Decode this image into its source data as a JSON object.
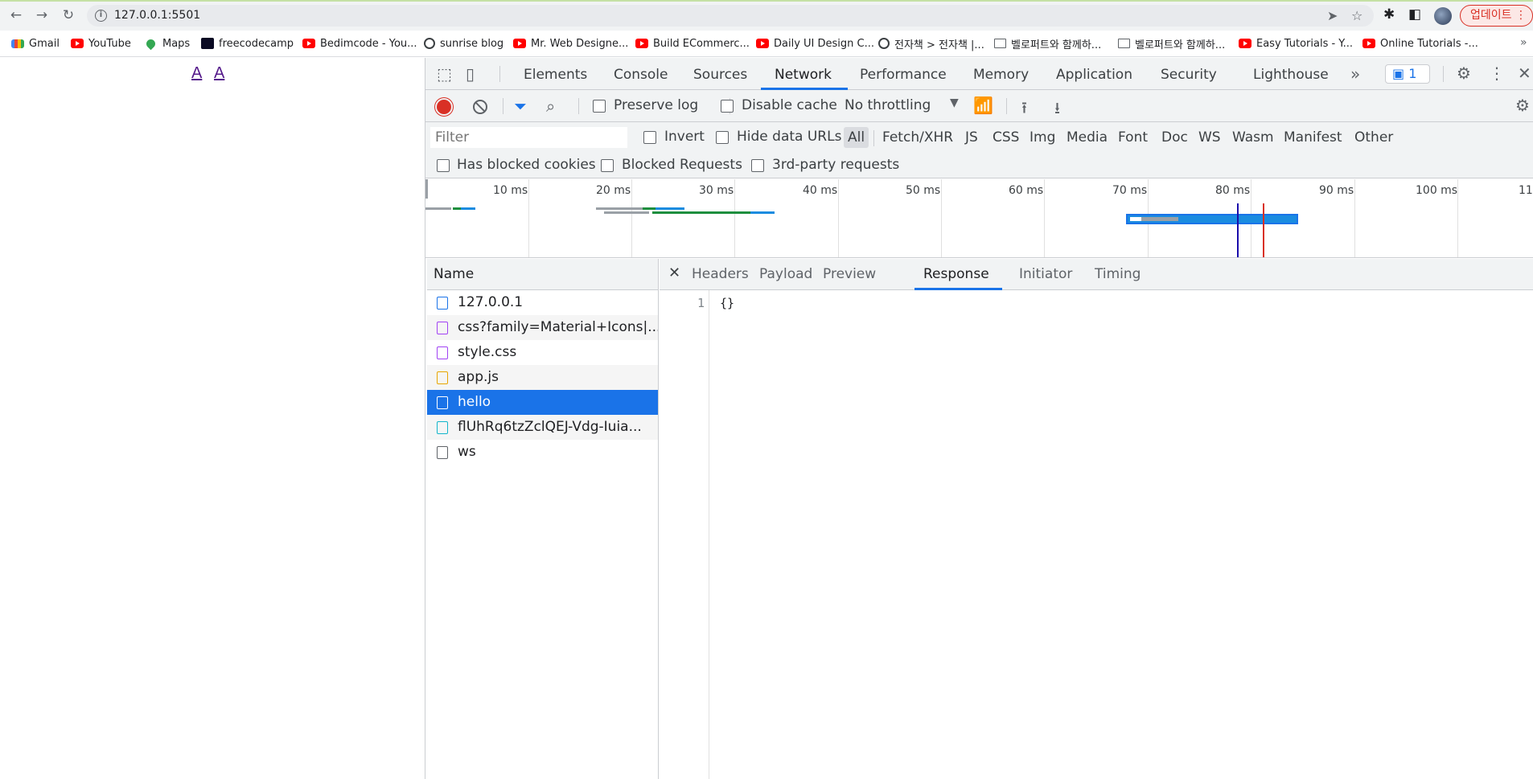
{
  "browser": {
    "url": "127.0.0.1:5501",
    "update_label": "업데이트",
    "bookmarks": [
      {
        "label": "Gmail",
        "icon": "gmail-icon"
      },
      {
        "label": "YouTube",
        "icon": "youtube-icon"
      },
      {
        "label": "Maps",
        "icon": "maps-icon"
      },
      {
        "label": "freecodecamp",
        "icon": "freecodecamp-icon"
      },
      {
        "label": "Bedimcode - You...",
        "icon": "youtube-icon"
      },
      {
        "label": "sunrise blog",
        "icon": "globe-icon"
      },
      {
        "label": "Mr. Web Designe...",
        "icon": "youtube-icon"
      },
      {
        "label": "Build ECommerc...",
        "icon": "youtube-icon"
      },
      {
        "label": "Daily UI Design C...",
        "icon": "youtube-icon"
      },
      {
        "label": "전자책 > 전자책 |...",
        "icon": "globe-icon"
      },
      {
        "label": "벨로퍼트와 함께하...",
        "icon": "book-icon"
      },
      {
        "label": "벨로퍼트와 함께하...",
        "icon": "book-icon"
      },
      {
        "label": "Easy Tutorials - Y...",
        "icon": "youtube-icon"
      },
      {
        "label": "Online Tutorials -...",
        "icon": "youtube-icon"
      }
    ]
  },
  "page": {
    "links": [
      "A",
      "A"
    ]
  },
  "devtools": {
    "tabs": [
      "Elements",
      "Console",
      "Sources",
      "Network",
      "Performance",
      "Memory",
      "Application",
      "Security",
      "Lighthouse"
    ],
    "active_tab": "Network",
    "issues_count": "1",
    "toolbar": {
      "preserve_log": "Preserve log",
      "disable_cache": "Disable cache",
      "throttling": "No throttling"
    },
    "filter": {
      "placeholder": "Filter",
      "invert": "Invert",
      "hide_data_urls": "Hide data URLs",
      "types": [
        "All",
        "Fetch/XHR",
        "JS",
        "CSS",
        "Img",
        "Media",
        "Font",
        "Doc",
        "WS",
        "Wasm",
        "Manifest",
        "Other"
      ],
      "has_blocked_cookies": "Has blocked cookies",
      "blocked_requests": "Blocked Requests",
      "third_party": "3rd-party requests"
    },
    "overview": {
      "ticks": [
        "10 ms",
        "20 ms",
        "30 ms",
        "40 ms",
        "50 ms",
        "60 ms",
        "70 ms",
        "80 ms",
        "90 ms",
        "100 ms",
        "11"
      ]
    },
    "requests": {
      "header": "Name",
      "items": [
        {
          "name": "127.0.0.1",
          "type": "doc"
        },
        {
          "name": "css?family=Material+Icons|...",
          "type": "css"
        },
        {
          "name": "style.css",
          "type": "css"
        },
        {
          "name": "app.js",
          "type": "js"
        },
        {
          "name": "hello",
          "type": "other",
          "selected": true
        },
        {
          "name": "flUhRq6tzZclQEJ-Vdg-Iuia...",
          "type": "font"
        },
        {
          "name": "ws",
          "type": "other"
        }
      ]
    },
    "detail": {
      "tabs": [
        "Headers",
        "Payload",
        "Preview",
        "Response",
        "Initiator",
        "Timing"
      ],
      "active_tab": "Response",
      "line_number": "1",
      "response": "{}"
    }
  }
}
